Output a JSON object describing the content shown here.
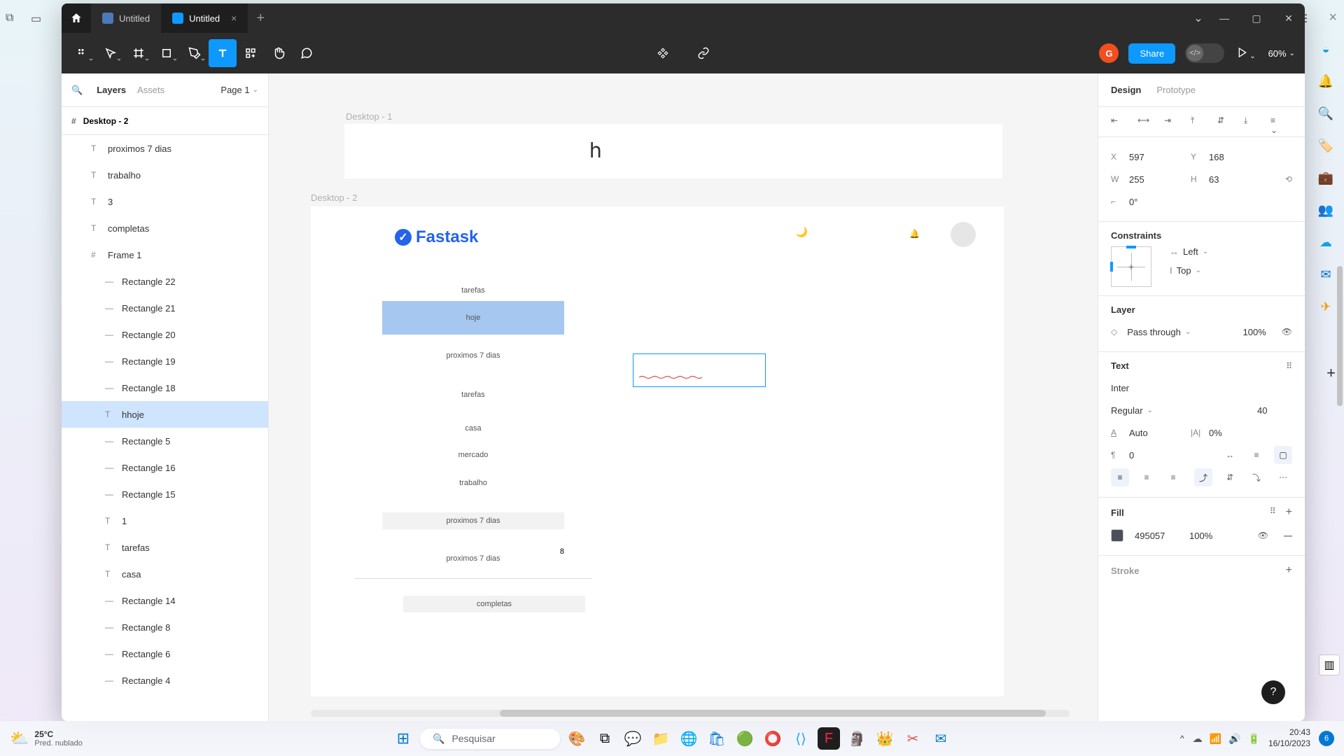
{
  "os": {
    "weather_temp": "25°C",
    "weather_desc": "Pred. nublado",
    "search_placeholder": "Pesquisar",
    "clock_time": "20:43",
    "clock_date": "16/10/2023",
    "notif_count": "6"
  },
  "window": {
    "tabs": [
      {
        "label": "Untitled",
        "active": false
      },
      {
        "label": "Untitled",
        "active": true
      }
    ]
  },
  "toolbar": {
    "share_label": "Share",
    "avatar_letter": "G",
    "zoom": "60%"
  },
  "left_panel": {
    "tab_layers": "Layers",
    "tab_assets": "Assets",
    "page_label": "Page 1",
    "frame_title": "Desktop - 2",
    "layers": [
      {
        "type": "T",
        "label": "proximos 7 dias",
        "indent": 0
      },
      {
        "type": "T",
        "label": "trabalho",
        "indent": 0
      },
      {
        "type": "T",
        "label": "3",
        "indent": 0
      },
      {
        "type": "T",
        "label": "completas",
        "indent": 0
      },
      {
        "type": "#",
        "label": "Frame 1",
        "indent": 0
      },
      {
        "type": "—",
        "label": "Rectangle 22",
        "indent": 1
      },
      {
        "type": "—",
        "label": "Rectangle 21",
        "indent": 1
      },
      {
        "type": "—",
        "label": "Rectangle 20",
        "indent": 1
      },
      {
        "type": "—",
        "label": "Rectangle 19",
        "indent": 1
      },
      {
        "type": "—",
        "label": "Rectangle 18",
        "indent": 1
      },
      {
        "type": "T",
        "label": "hhoje",
        "indent": 1,
        "selected": true
      },
      {
        "type": "—",
        "label": "Rectangle 5",
        "indent": 1
      },
      {
        "type": "—",
        "label": "Rectangle 16",
        "indent": 1
      },
      {
        "type": "—",
        "label": "Rectangle 15",
        "indent": 1
      },
      {
        "type": "T",
        "label": "1",
        "indent": 1
      },
      {
        "type": "T",
        "label": "tarefas",
        "indent": 1
      },
      {
        "type": "T",
        "label": "casa",
        "indent": 1
      },
      {
        "type": "—",
        "label": "Rectangle 14",
        "indent": 1
      },
      {
        "type": "—",
        "label": "Rectangle 8",
        "indent": 1
      },
      {
        "type": "—",
        "label": "Rectangle 6",
        "indent": 1
      },
      {
        "type": "—",
        "label": "Rectangle 4",
        "indent": 1
      }
    ]
  },
  "canvas": {
    "label_desktop1": "Desktop - 1",
    "label_desktop2": "Desktop - 2",
    "h_text": "h",
    "brand_name": "Fastask",
    "sidebar_header": "tarefas",
    "item_hoje": "hoje",
    "item_prox": "proximos 7 dias",
    "item_tarefas2": "tarefas",
    "item_casa": "casa",
    "item_mercado": "mercado",
    "item_trabalho": "trabalho",
    "sect_prox7": "proximos 7  dias",
    "badge_8": "8",
    "item_prox7b": "proximos 7  dias",
    "sect_completas": "completas"
  },
  "right_panel": {
    "tab_design": "Design",
    "tab_proto": "Prototype",
    "x_label": "X",
    "x_val": "597",
    "y_label": "Y",
    "y_val": "168",
    "w_label": "W",
    "w_val": "255",
    "h_label": "H",
    "h_val": "63",
    "rot_val": "0°",
    "constraints_title": "Constraints",
    "constraint_h": "Left",
    "constraint_v": "Top",
    "layer_title": "Layer",
    "blend_mode": "Pass through",
    "opacity": "100%",
    "text_title": "Text",
    "font_family": "Inter",
    "font_weight": "Regular",
    "font_size": "40",
    "line_height": "Auto",
    "letter_spacing": "0%",
    "paragraph": "0",
    "fill_title": "Fill",
    "fill_hex": "495057",
    "fill_opacity": "100%",
    "stroke_title": "Stroke"
  }
}
